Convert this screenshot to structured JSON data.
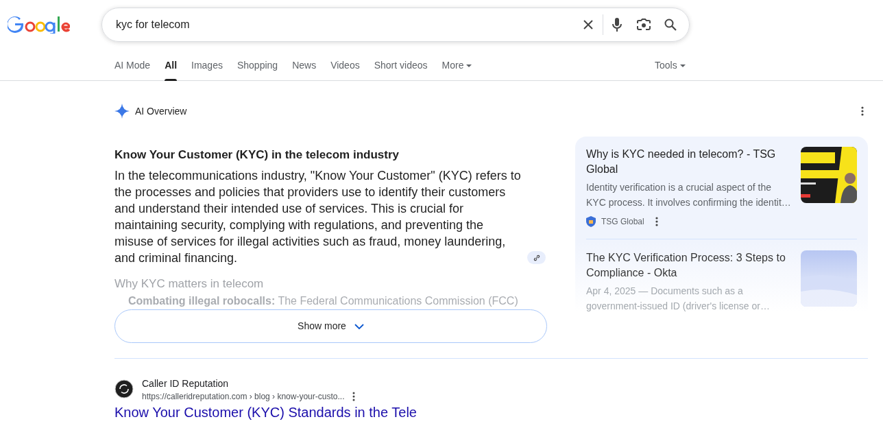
{
  "search": {
    "query": "kyc for telecom"
  },
  "tabs": [
    {
      "label": "AI Mode",
      "selected": false,
      "caret": false
    },
    {
      "label": "All",
      "selected": true,
      "caret": false
    },
    {
      "label": "Images",
      "selected": false,
      "caret": false
    },
    {
      "label": "Shopping",
      "selected": false,
      "caret": false
    },
    {
      "label": "News",
      "selected": false,
      "caret": false
    },
    {
      "label": "Videos",
      "selected": false,
      "caret": false
    },
    {
      "label": "Short videos",
      "selected": false,
      "caret": false
    },
    {
      "label": "More",
      "selected": false,
      "caret": true
    }
  ],
  "tools": {
    "label": "Tools"
  },
  "ai_overview": {
    "label": "AI Overview",
    "heading": "Know Your Customer (KYC) in the telecom industry",
    "paragraph": "In the telecommunications industry, \"Know Your Customer\" (KYC) refers to the processes and policies that providers use to identify their customers and understand their intended use of services. This is crucial for maintaining security, complying with regulations, and preventing the misuse of services for illegal activities such as fraud, money laundering, and criminal financing.",
    "faded_heading": "Why KYC matters in telecom",
    "faded_bullet": "**Combating illegal robocalls:** The Federal Communications Commission (FCC)",
    "show_more": "Show more",
    "sources": [
      {
        "title": "Why is KYC needed in telecom? - TSG Global",
        "snippet": "Identity verification is a crucial aspect of the KYC process. It involves confirming the identit…",
        "site": "TSG Global",
        "faded": false
      },
      {
        "title": "The KYC Verification Process: 3 Steps to Compliance - Okta",
        "snippet": "Apr 4, 2025 — Documents such as a government-issued ID (driver's license or…",
        "faded": true
      }
    ]
  },
  "results": [
    {
      "site": "Caller ID Reputation",
      "url": "https://calleridreputation.com › blog › know-your-custo...",
      "title": "Know Your Customer (KYC) Standards in the Tele"
    }
  ]
}
